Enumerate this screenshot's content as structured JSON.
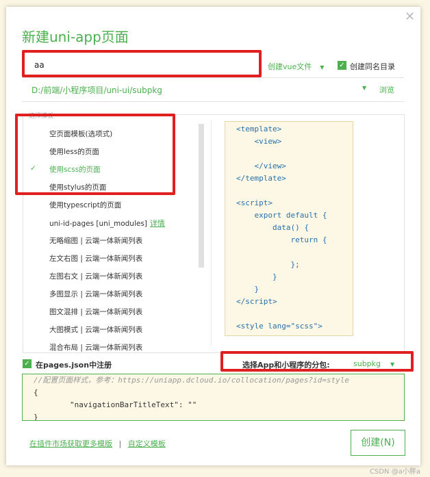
{
  "dialog": {
    "title": "新建uni-app页面",
    "close_icon": "close-icon"
  },
  "name_input": {
    "value": "aa"
  },
  "file_type": {
    "label": "创建vue文件"
  },
  "same_dir": {
    "label": "创建同名目录",
    "checked": true
  },
  "path": {
    "value": "D:/前端/小程序项目/uni-ui/subpkg",
    "browse": "浏览"
  },
  "templates": {
    "label": "选择模板",
    "selected_index": 2,
    "items": [
      {
        "label": "空页面模板(选项式)"
      },
      {
        "label": "使用less的页面"
      },
      {
        "label": "使用scss的页面"
      },
      {
        "label": "使用stylus的页面"
      },
      {
        "label": "使用typescript的页面"
      },
      {
        "label": "uni-id-pages [uni_modules]",
        "link": "详情"
      },
      {
        "label": "无略缩图 | 云端一体新闻列表"
      },
      {
        "label": "左文右图 | 云端一体新闻列表"
      },
      {
        "label": "左图右文 | 云端一体新闻列表"
      },
      {
        "label": "多图显示 | 云端一体新闻列表"
      },
      {
        "label": "图文混排 | 云端一体新闻列表"
      },
      {
        "label": "大图模式 | 云端一体新闻列表"
      },
      {
        "label": "混合布局 | 云端一体新闻列表"
      }
    ]
  },
  "preview": {
    "lines": [
      "<template>",
      "    <view>",
      "",
      "    </view>",
      "</template>",
      "",
      "<script>",
      "    export default {",
      "        data() {",
      "            return {",
      "",
      "            };",
      "        }",
      "    }",
      "</script>",
      "",
      "<style lang=\"scss\">"
    ]
  },
  "register": {
    "label": "在pages.json中注册",
    "checked": true
  },
  "subpackage": {
    "label": "选择App和小程序的分包:",
    "value": "subpkg"
  },
  "json_config": {
    "lines": [
      "//配置页面样式，参考：https://uniapp.dcloud.io/collocation/pages?id=style",
      "{",
      "        \"navigationBarTitleText\": \"\"",
      "}"
    ]
  },
  "footer": {
    "market_link": "在插件市场获取更多模版",
    "separator": "|",
    "custom_link": "自定义模板",
    "create_button": "创建(N)"
  },
  "watermark": "CSDN @a小胖a"
}
